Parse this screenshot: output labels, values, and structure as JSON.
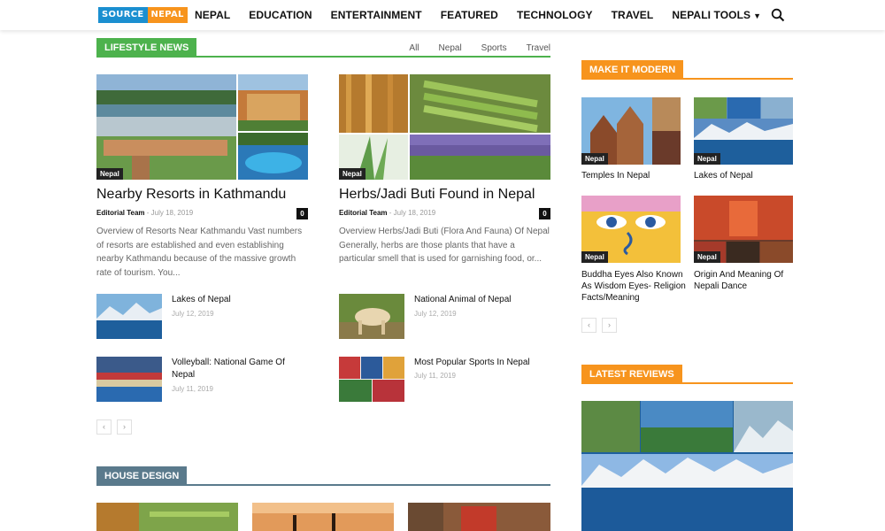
{
  "header": {
    "logo_left": "SOURCE",
    "logo_right": "NEPAL",
    "nav": [
      "NEPAL",
      "EDUCATION",
      "ENTERTAINMENT",
      "FEATURED",
      "TECHNOLOGY",
      "TRAVEL",
      "NEPALI TOOLS"
    ]
  },
  "lifestyle": {
    "heading": "LIFESTYLE NEWS",
    "filters": [
      "All",
      "Nepal",
      "Sports",
      "Travel"
    ],
    "featured": [
      {
        "badge": "Nepal",
        "title": "Nearby Resorts in Kathmandu",
        "author": "Editorial Team",
        "date": "July 18, 2019",
        "comments": "0",
        "excerpt": "Overview of Resorts Near Kathmandu Vast numbers of resorts are established and even establishing nearby Kathmandu because of the massive growth rate of tourism. You..."
      },
      {
        "badge": "Nepal",
        "title": "Herbs/Jadi Buti Found in Nepal",
        "author": "Editorial Team",
        "date": "July 18, 2019",
        "comments": "0",
        "excerpt": "Overview Herbs/Jadi Buti (Flora And Fauna) Of Nepal Generally, herbs are those plants that have a particular smell that is used for garnishing food, or..."
      }
    ],
    "small": [
      {
        "title": "Lakes of Nepal",
        "date": "July 12, 2019"
      },
      {
        "title": "National Animal of Nepal",
        "date": "July 12, 2019"
      },
      {
        "title": "Volleyball: National Game Of Nepal",
        "date": "July 11, 2019"
      },
      {
        "title": "Most Popular Sports In Nepal",
        "date": "July 11, 2019"
      }
    ],
    "pager": [
      "‹",
      "›"
    ]
  },
  "house": {
    "heading": "HOUSE DESIGN"
  },
  "modern": {
    "heading": "MAKE IT MODERN",
    "items": [
      {
        "badge": "Nepal",
        "title": "Temples In Nepal"
      },
      {
        "badge": "Nepal",
        "title": "Lakes of Nepal"
      },
      {
        "badge": "Nepal",
        "title": "Buddha Eyes Also Known As Wisdom Eyes- Religion Facts/Meaning"
      },
      {
        "badge": "Nepal",
        "title": "Origin And Meaning Of Nepali Dance"
      }
    ],
    "pager": [
      "‹",
      "›"
    ]
  },
  "reviews": {
    "heading": "LATEST REVIEWS"
  },
  "colors": {
    "green": "#4db24d",
    "orange": "#f7941d",
    "slate": "#5a7a8c",
    "brand_blue": "#1b8fd0"
  }
}
